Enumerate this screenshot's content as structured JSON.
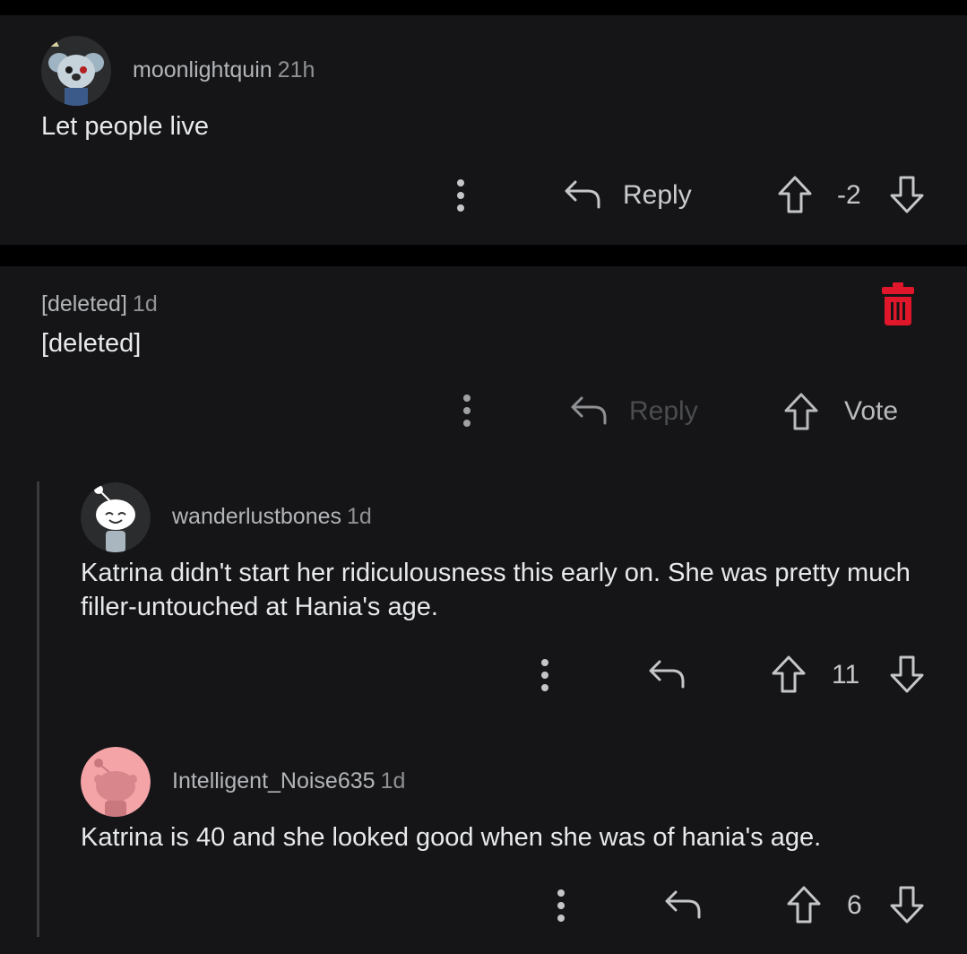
{
  "comments": [
    {
      "author": "moonlightquin",
      "age": "21h",
      "body": "Let people live",
      "reply_label": "Reply",
      "score": "-2"
    },
    {
      "author": "[deleted]",
      "age": "1d",
      "body": "[deleted]",
      "reply_label": "Reply",
      "vote_label": "Vote"
    },
    {
      "author": "wanderlustbones",
      "age": "1d",
      "body": "Katrina didn't start her ridiculousness this early on. She was pretty much filler-untouched at Hania's age.",
      "score": "11"
    },
    {
      "author": "Intelligent_Noise635",
      "age": "1d",
      "body": "Katrina is 40 and she looked good when she was of hania's age.",
      "score": "6"
    }
  ],
  "colors": {
    "background": "#000000",
    "card": "#151517",
    "delete_red": "#e0162b",
    "avatar_pink": "#f4a3a7"
  },
  "icons": [
    "more-options-icon",
    "reply-arrow-icon",
    "upvote-arrow-icon",
    "downvote-arrow-icon",
    "trash-icon"
  ]
}
